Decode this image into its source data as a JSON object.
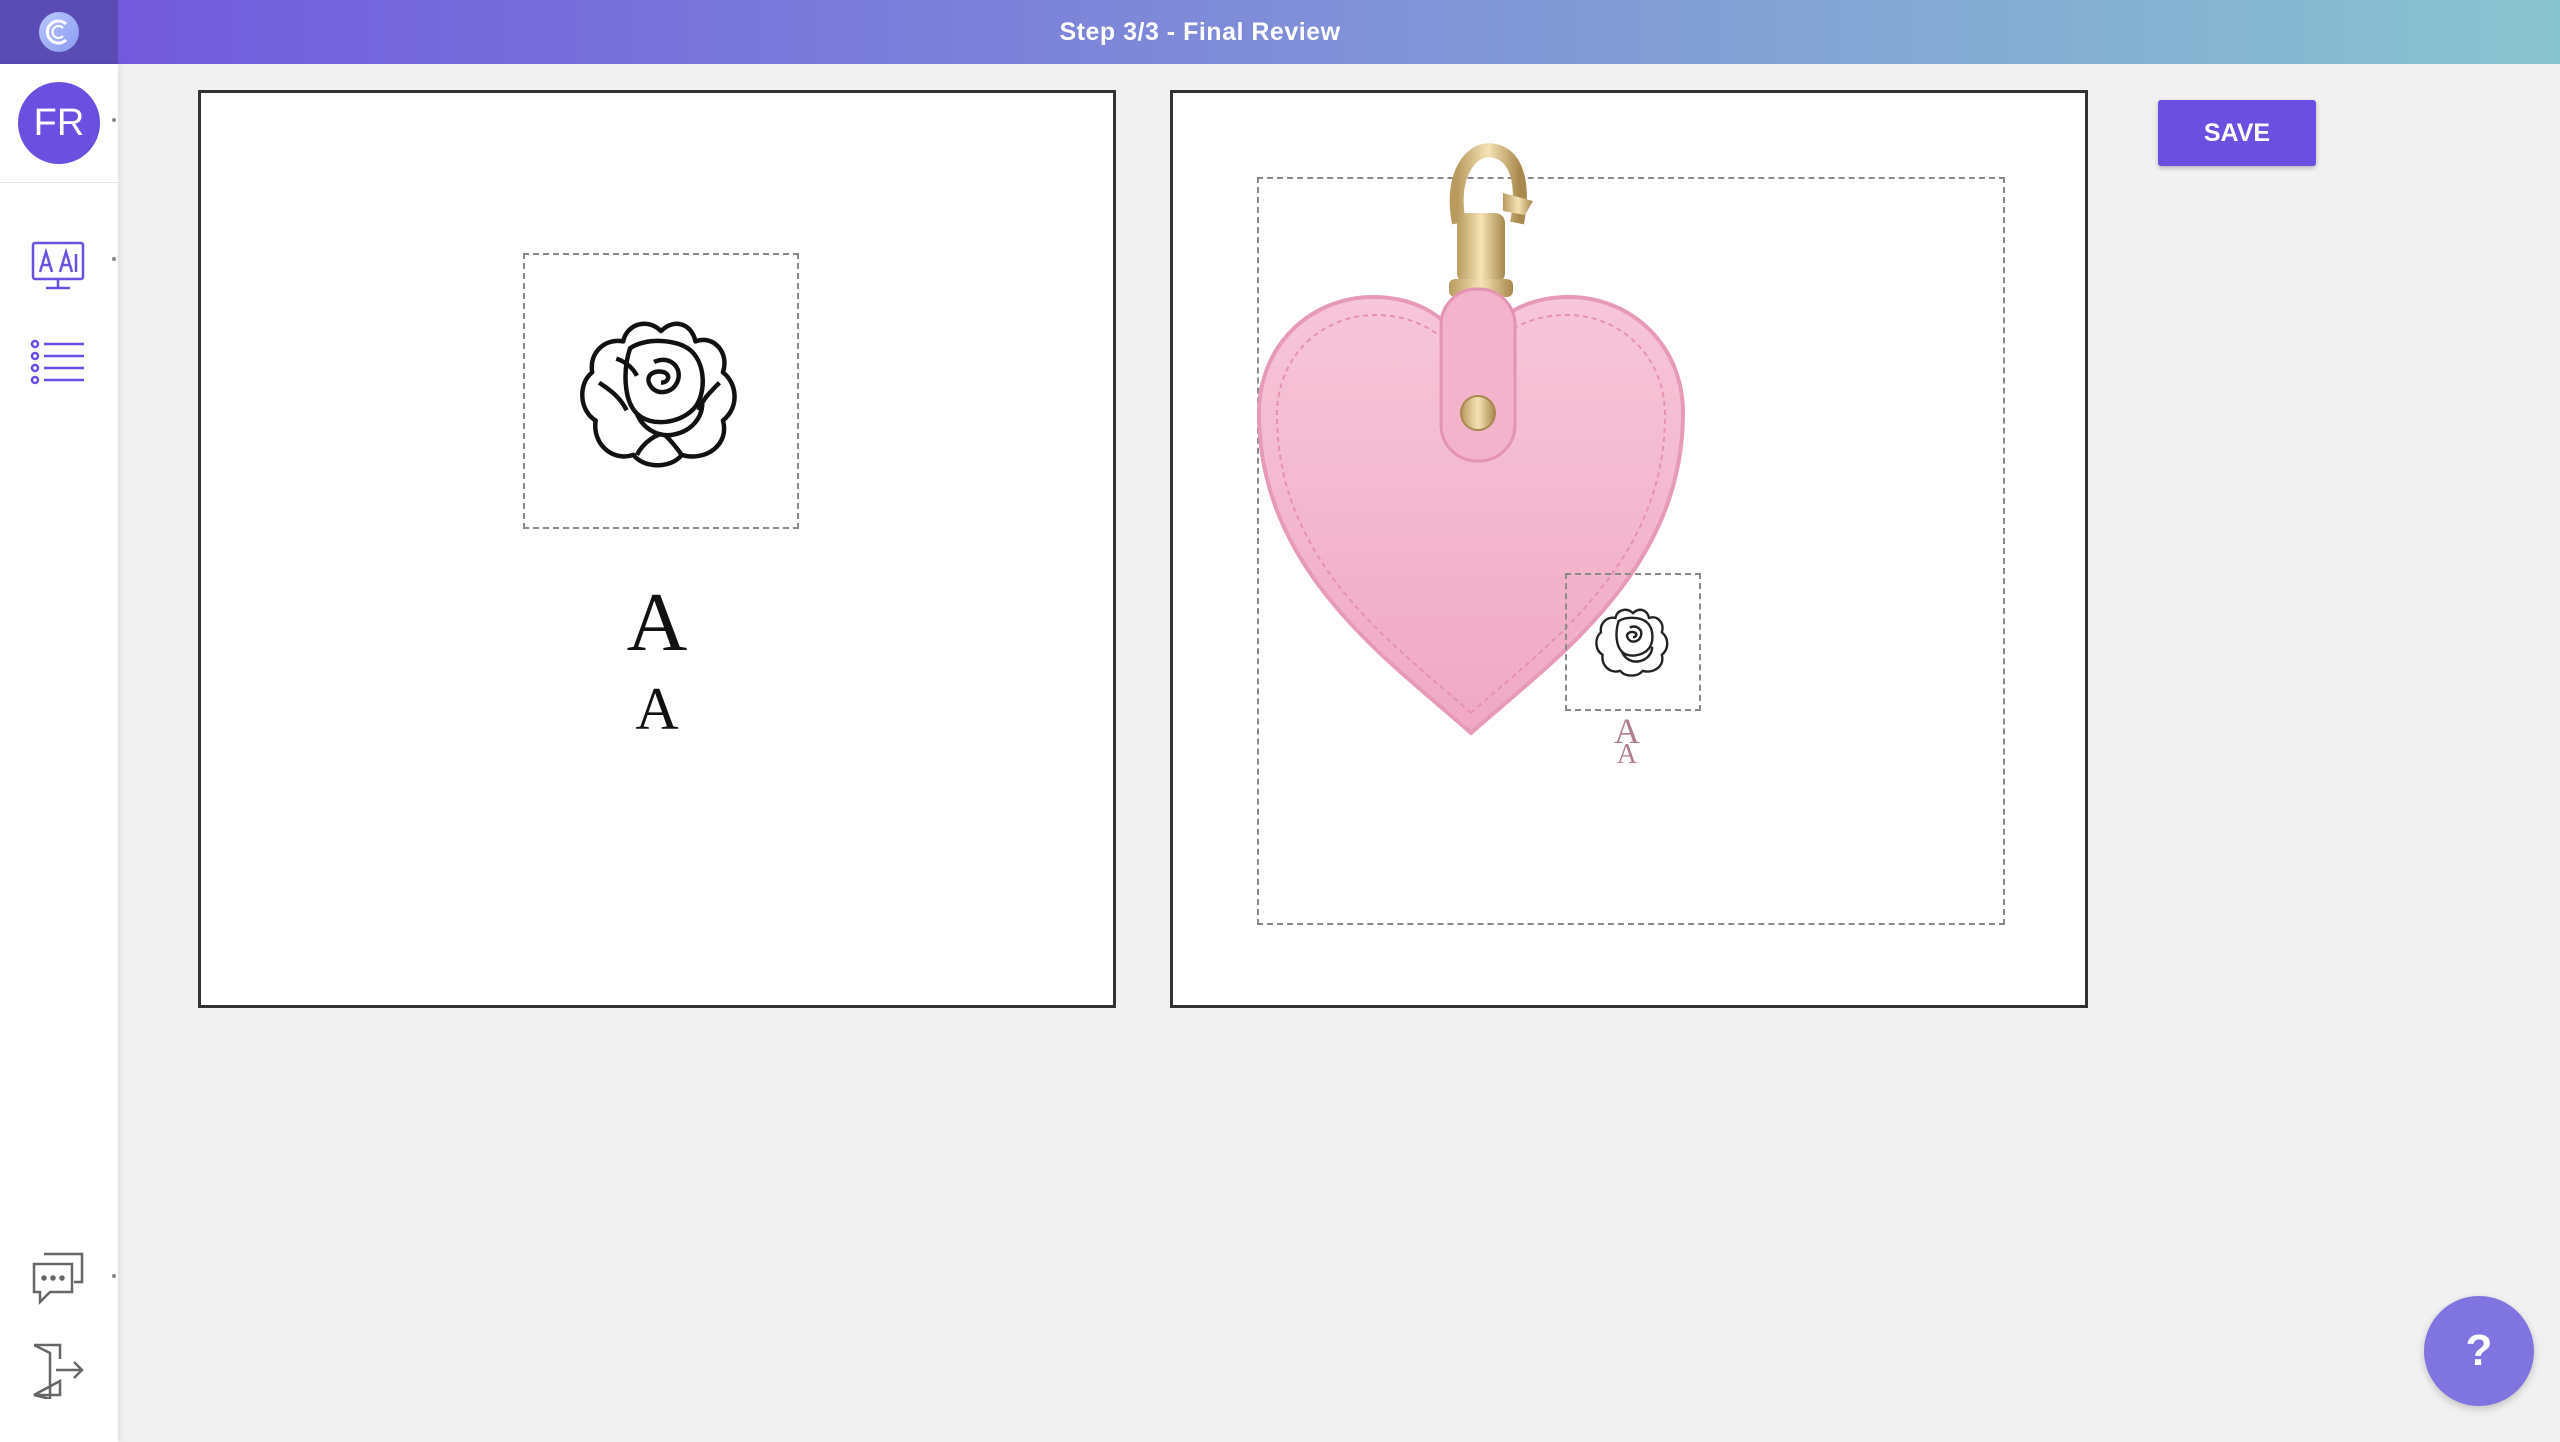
{
  "header": {
    "title": "Step 3/3 - Final Review"
  },
  "sidebar": {
    "avatar_initials": "FR",
    "icons": [
      "design-monitor-icon",
      "list-icon",
      "chat-icon",
      "logout-door-icon"
    ]
  },
  "design_panel": {
    "monogram_line_1": "A",
    "monogram_line_2": "A"
  },
  "preview_panel": {
    "monogram_line_1": "A",
    "monogram_line_2": "A",
    "product_color": "#f4b8cf"
  },
  "actions": {
    "save_label": "SAVE",
    "help_label": "?"
  },
  "colors": {
    "accent": "#6a4fe0",
    "gradient_start": "#7055dd",
    "gradient_end": "#88c4cf"
  }
}
